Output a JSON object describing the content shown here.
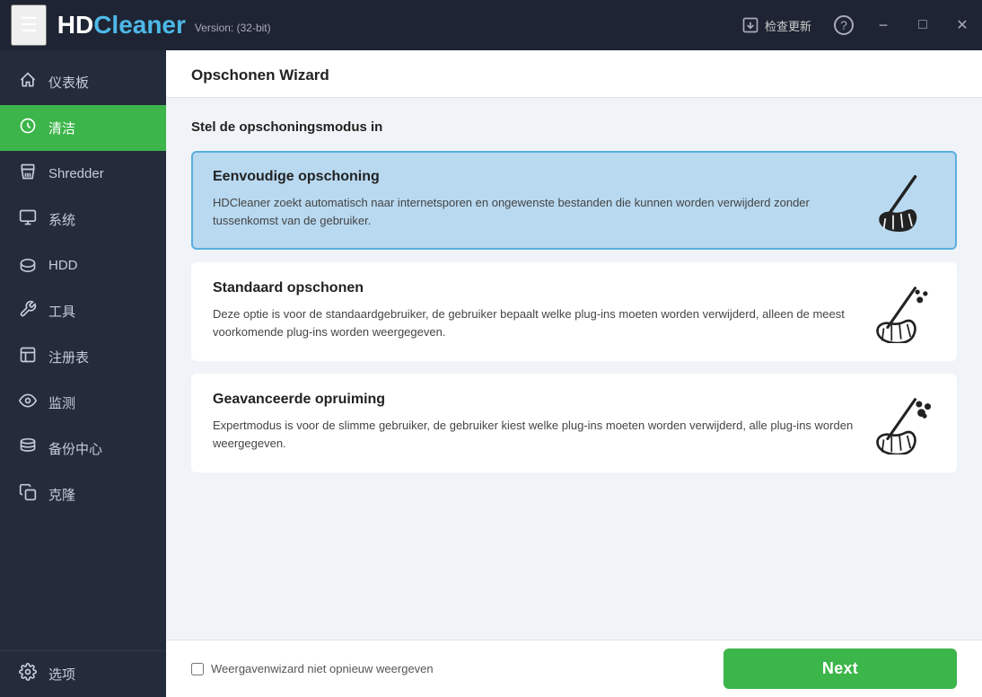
{
  "app": {
    "name_hd": "HD",
    "name_cleaner": "Cleaner",
    "version": "Version:  (32-bit)"
  },
  "titlebar": {
    "update_label": "检查更新",
    "help_icon": "?",
    "minimize_icon": "−",
    "maximize_icon": "□",
    "close_icon": "✕"
  },
  "sidebar": {
    "items": [
      {
        "id": "dashboard",
        "label": "仪表板",
        "icon": "🏠"
      },
      {
        "id": "clean",
        "label": "清洁",
        "icon": "♻",
        "active": true
      },
      {
        "id": "shredder",
        "label": "Shredder",
        "icon": "⚙"
      },
      {
        "id": "system",
        "label": "系统",
        "icon": "🖥"
      },
      {
        "id": "hdd",
        "label": "HDD",
        "icon": "💾"
      },
      {
        "id": "tools",
        "label": "工具",
        "icon": "🔧"
      },
      {
        "id": "registry",
        "label": "注册表",
        "icon": "📋"
      },
      {
        "id": "monitor",
        "label": "监测",
        "icon": "👁"
      },
      {
        "id": "backup",
        "label": "备份中心",
        "icon": "🗄"
      },
      {
        "id": "clone",
        "label": "克隆",
        "icon": "📄"
      }
    ],
    "bottom_item": {
      "id": "options",
      "label": "选项",
      "icon": "⚙"
    }
  },
  "page": {
    "title": "Opschonen Wizard",
    "section_title": "Stel de opschoningsmodus in"
  },
  "options": [
    {
      "id": "simple",
      "title": "Eenvoudige opschoning",
      "description": "HDCleaner zoekt automatisch naar internetsporen en ongewenste bestanden die kunnen worden verwijderd zonder tussenkomst van de gebruiker.",
      "selected": true
    },
    {
      "id": "standard",
      "title": "Standaard opschonen",
      "description": "Deze optie is voor de standaardgebruiker, de gebruiker bepaalt welke plug-ins moeten worden verwijderd, alleen de meest voorkomende plug-ins worden weergegeven.",
      "selected": false
    },
    {
      "id": "advanced",
      "title": "Geavanceerde opruiming",
      "description": "Expertmodus is voor de slimme gebruiker, de gebruiker kiest welke plug-ins moeten worden verwijderd, alle plug-ins worden weergegeven.",
      "selected": false
    }
  ],
  "footer": {
    "checkbox_label": "Weergavenwizard niet opnieuw weergeven",
    "next_button": "Next"
  }
}
